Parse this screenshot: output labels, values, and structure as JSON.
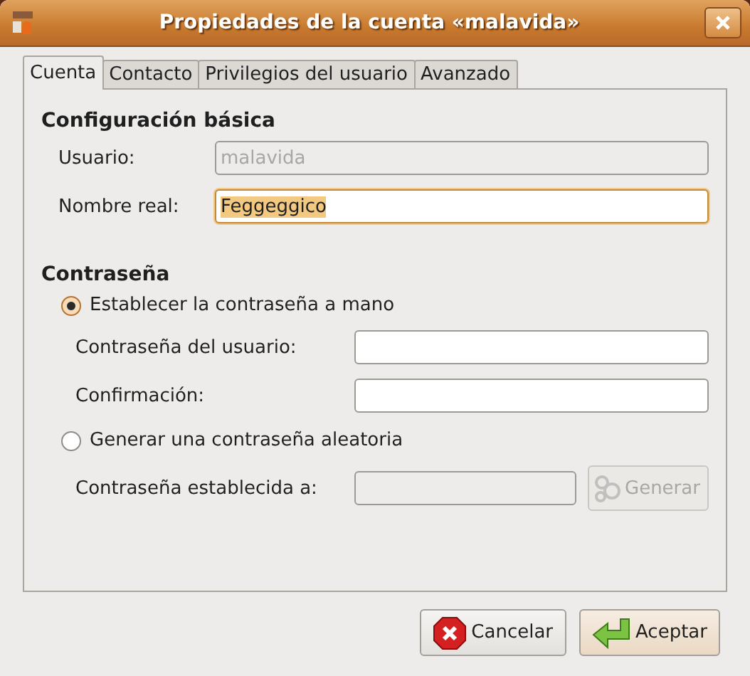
{
  "window": {
    "title": "Propiedades de la cuenta «malavida»"
  },
  "tabs": [
    {
      "label": "Cuenta",
      "selected": true
    },
    {
      "label": "Contacto",
      "selected": false
    },
    {
      "label": "Privilegios del usuario",
      "selected": false
    },
    {
      "label": "Avanzado",
      "selected": false
    }
  ],
  "basic": {
    "heading": "Configuración básica",
    "fields": [
      {
        "label": "Usuario:",
        "value": "malavida",
        "disabled": true,
        "focused": false
      },
      {
        "label": "Nombre real:",
        "value": "Feggeggico",
        "disabled": false,
        "focused": true
      }
    ]
  },
  "password": {
    "heading": "Contraseña",
    "options": [
      {
        "label": "Establecer la contraseña a mano",
        "selected": true
      },
      {
        "label": "Generar una contraseña aleatoria",
        "selected": false
      }
    ],
    "manual_fields": [
      {
        "label": "Contraseña del usuario:"
      },
      {
        "label": "Confirmación:"
      }
    ],
    "generated": {
      "label": "Contraseña establecida a:",
      "disabled": true,
      "button": {
        "label": "Generar",
        "disabled": true
      }
    }
  },
  "buttons": [
    {
      "label": "Cancelar",
      "kind": "cancel",
      "default": false
    },
    {
      "label": "Aceptar",
      "kind": "ok",
      "default": true
    }
  ]
}
